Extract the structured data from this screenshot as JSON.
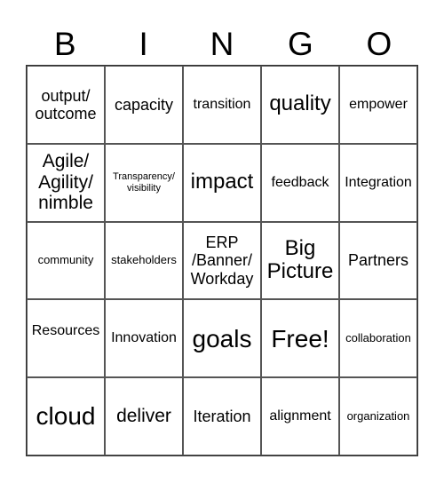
{
  "card": {
    "header": [
      "B",
      "I",
      "N",
      "G",
      "O"
    ],
    "rows": [
      [
        {
          "text": "output/\noutcome",
          "size": "lg"
        },
        {
          "text": "capacity",
          "size": "lg"
        },
        {
          "text": "transition",
          "size": "md"
        },
        {
          "text": "quality",
          "size": "xxl"
        },
        {
          "text": "empower",
          "size": "md"
        }
      ],
      [
        {
          "text": "Agile/\nAgility/\nnimble",
          "size": "xl"
        },
        {
          "text": "Transparency/\nvisibility",
          "size": "xs"
        },
        {
          "text": "impact",
          "size": "xxl"
        },
        {
          "text": "feedback",
          "size": "md"
        },
        {
          "text": "Integration",
          "size": "md"
        }
      ],
      [
        {
          "text": "community",
          "size": "sm"
        },
        {
          "text": "stakeholders",
          "size": "sm"
        },
        {
          "text": "ERP\n/Banner/\nWorkday",
          "size": "lg"
        },
        {
          "text": "Big\nPicture",
          "size": "xxl"
        },
        {
          "text": "Partners",
          "size": "lg"
        }
      ],
      [
        {
          "text": "Resources",
          "size": "md",
          "align": "top"
        },
        {
          "text": "Innovation",
          "size": "md"
        },
        {
          "text": "goals",
          "size": "huge"
        },
        {
          "text": "Free!",
          "size": "huge"
        },
        {
          "text": "collaboration",
          "size": "sm"
        }
      ],
      [
        {
          "text": "cloud",
          "size": "huge"
        },
        {
          "text": "deliver",
          "size": "xl"
        },
        {
          "text": "Iteration",
          "size": "lg"
        },
        {
          "text": "alignment",
          "size": "md"
        },
        {
          "text": "organization",
          "size": "sm"
        }
      ]
    ]
  }
}
